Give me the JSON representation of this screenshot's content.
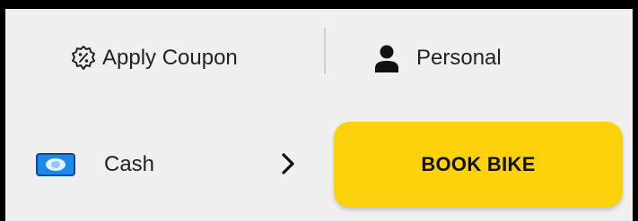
{
  "header": {
    "coupon": {
      "label": "Apply Coupon",
      "icon": "discount-badge-icon"
    },
    "profile": {
      "label": "Personal",
      "icon": "person-icon"
    }
  },
  "payment": {
    "method_label": "Cash",
    "icon": "cash-icon",
    "chevron": "chevron-right-icon"
  },
  "action": {
    "book_label": "BOOK BIKE"
  },
  "colors": {
    "accent": "#fad10b",
    "background": "#f0f0f0",
    "cash_icon": "#1e88e5"
  }
}
